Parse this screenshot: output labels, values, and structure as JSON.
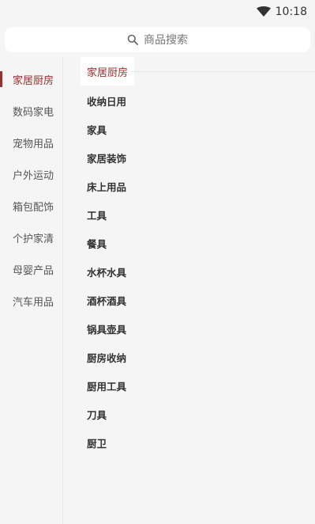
{
  "status_bar": {
    "time": "10:18"
  },
  "search": {
    "placeholder": "商品搜索"
  },
  "sidebar": {
    "items": [
      {
        "label": "家居厨房",
        "active": true
      },
      {
        "label": "数码家电"
      },
      {
        "label": "宠物用品"
      },
      {
        "label": "户外运动"
      },
      {
        "label": "箱包配饰"
      },
      {
        "label": "个护家清"
      },
      {
        "label": "母婴产品"
      },
      {
        "label": "汽车用品"
      }
    ]
  },
  "main": {
    "header": "家居厨房",
    "categories": [
      "收纳日用",
      "家具",
      "家居装饰",
      "床上用品",
      "工具",
      "餐具",
      "水杯水具",
      "酒杯酒具",
      "锅具壶具",
      "厨房收纳",
      "厨用工具",
      "刀具",
      "厨卫"
    ]
  },
  "colors": {
    "accent": "#9c2e2e",
    "background": "#f5f5f5"
  }
}
